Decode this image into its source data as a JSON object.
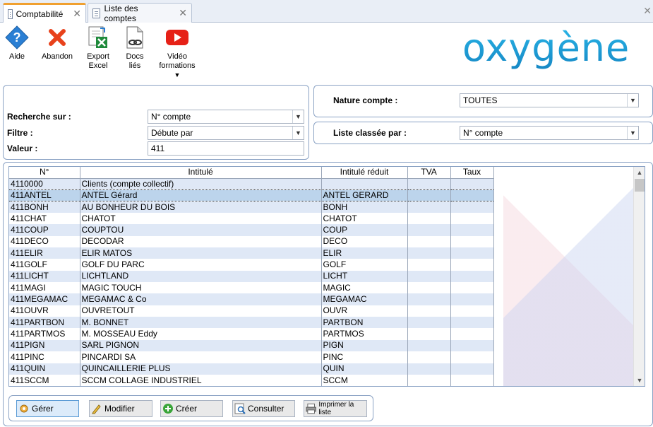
{
  "tabs": [
    {
      "label": "Comptabilité",
      "active": true
    },
    {
      "label": "Liste des comptes",
      "active": false
    }
  ],
  "toolbar": {
    "aide": "Aide",
    "abandon": "Abandon",
    "export_line1": "Export",
    "export_line2": "Excel",
    "docs_line1": "Docs",
    "docs_line2": "liés",
    "video_line1": "Vidéo",
    "video_line2": "formations"
  },
  "logo": "oxygène",
  "filters": {
    "recherche_label": "Recherche sur :",
    "recherche_value": "N° compte",
    "filtre_label": "Filtre :",
    "filtre_value": "Débute par",
    "valeur_label": "Valeur :",
    "valeur_value": "411",
    "nature_label": "Nature compte :",
    "nature_value": "TOUTES",
    "classee_label": "Liste classée par :",
    "classee_value": "N° compte"
  },
  "table": {
    "columns": [
      "N°",
      "Intitulé",
      "Intitulé réduit",
      "TVA",
      "Taux"
    ],
    "selected_index": 1,
    "rows": [
      [
        "4110000",
        "Clients (compte collectif)",
        "",
        "",
        ""
      ],
      [
        "411ANTEL",
        "ANTEL Gérard",
        "ANTEL GERARD",
        "",
        ""
      ],
      [
        "411BONH",
        "AU BONHEUR DU BOIS",
        "BONH",
        "",
        ""
      ],
      [
        "411CHAT",
        "CHATOT",
        "CHATOT",
        "",
        ""
      ],
      [
        "411COUP",
        "COUPTOU",
        "COUP",
        "",
        ""
      ],
      [
        "411DECO",
        "DECODAR",
        "DECO",
        "",
        ""
      ],
      [
        "411ELIR",
        "ELIR MATOS",
        "ELIR",
        "",
        ""
      ],
      [
        "411GOLF",
        "GOLF DU PARC",
        "GOLF",
        "",
        ""
      ],
      [
        "411LICHT",
        "LICHTLAND",
        "LICHT",
        "",
        ""
      ],
      [
        "411MAGI",
        "MAGIC TOUCH",
        "MAGIC",
        "",
        ""
      ],
      [
        "411MEGAMAC",
        "MEGAMAC & Co",
        "MEGAMAC",
        "",
        ""
      ],
      [
        "411OUVR",
        "OUVRETOUT",
        "OUVR",
        "",
        ""
      ],
      [
        "411PARTBON",
        "M. BONNET",
        "PARTBON",
        "",
        ""
      ],
      [
        "411PARTMOS",
        "M. MOSSEAU Eddy",
        "PARTMOS",
        "",
        ""
      ],
      [
        "411PIGN",
        "SARL PIGNON",
        "PIGN",
        "",
        ""
      ],
      [
        "411PINC",
        "PINCARDI SA",
        "PINC",
        "",
        ""
      ],
      [
        "411QUIN",
        "QUINCAILLERIE PLUS",
        "QUIN",
        "",
        ""
      ],
      [
        "411SCCM",
        "SCCM COLLAGE INDUSTRIEL",
        "SCCM",
        "",
        ""
      ]
    ]
  },
  "actions": {
    "gerer": "Gérer",
    "modifier": "Modifier",
    "creer": "Créer",
    "consulter": "Consulter",
    "imprimer": "Imprimer la liste"
  }
}
